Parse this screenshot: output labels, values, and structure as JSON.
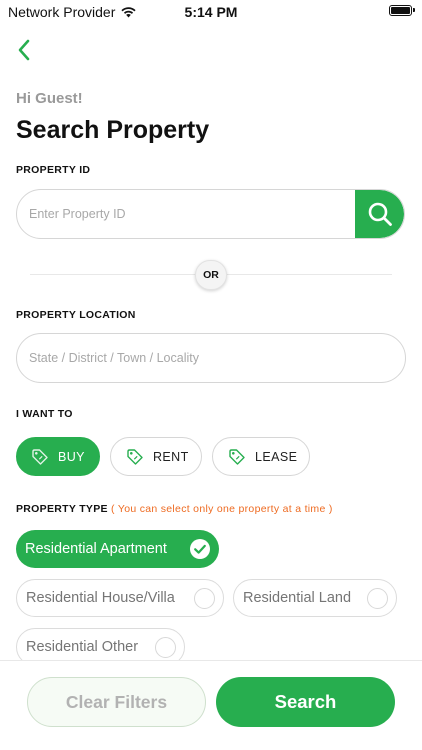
{
  "status_bar": {
    "carrier": "Network Provider",
    "time": "5:14 PM"
  },
  "header": {
    "greeting": "Hi Guest!",
    "title": "Search Property"
  },
  "property_id": {
    "label": "PROPERTY ID",
    "placeholder": "Enter Property ID"
  },
  "divider": {
    "text": "OR"
  },
  "property_location": {
    "label": "PROPERTY LOCATION",
    "placeholder": "State / District / Town / Locality"
  },
  "intent": {
    "label": "I WANT TO",
    "options": [
      {
        "label": "BUY",
        "selected": true
      },
      {
        "label": "RENT",
        "selected": false
      },
      {
        "label": "LEASE",
        "selected": false
      }
    ]
  },
  "property_type": {
    "label": "PROPERTY TYPE",
    "note": "( You can select only one property at a time )",
    "options": [
      {
        "label": "Residential Apartment",
        "selected": true
      },
      {
        "label": "Residential House/Villa",
        "selected": false
      },
      {
        "label": "Residential Land",
        "selected": false
      },
      {
        "label": "Residential Other",
        "selected": false
      }
    ]
  },
  "actions": {
    "clear_label": "Clear Filters",
    "search_label": "Search"
  },
  "colors": {
    "accent": "#27ae4f",
    "note": "#ee6b22",
    "muted_text": "#9a9a9a"
  },
  "icons": {
    "back": "chevron-left-icon",
    "search": "search-icon",
    "intent": "price-tag-icon",
    "selected": "check-circle-icon"
  }
}
